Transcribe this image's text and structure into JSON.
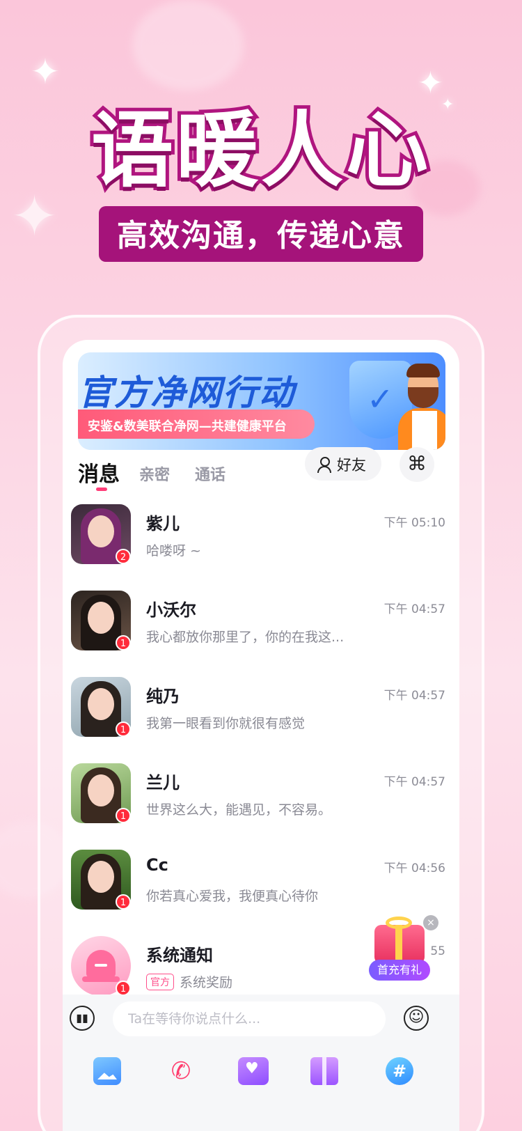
{
  "promo": {
    "headline": "语暖人心",
    "subline": "高效沟通，传递心意"
  },
  "banner": {
    "title": "官方净网行动",
    "subtitle": "安鉴&数美联合净网—共建健康平台"
  },
  "tabs": [
    {
      "label": "消息",
      "active": true
    },
    {
      "label": "亲密",
      "active": false
    },
    {
      "label": "通话",
      "active": false
    }
  ],
  "friends_button": "好友",
  "grid_icon": "⌘",
  "conversations": [
    {
      "name": "紫儿",
      "time": "下午 05:10",
      "preview": "哈喽呀 ~",
      "unread": "2"
    },
    {
      "name": "小沃尔",
      "time": "下午 04:57",
      "preview": "我心都放你那里了，你的在我这...",
      "unread": "1"
    },
    {
      "name": "纯乃",
      "time": "下午 04:57",
      "preview": "我第一眼看到你就很有感觉",
      "unread": "1"
    },
    {
      "name": "兰儿",
      "time": "下午 04:57",
      "preview": "世界这么大，能遇见，不容易。",
      "unread": "1"
    },
    {
      "name": "Cc",
      "time": "下午 04:56",
      "preview": "你若真心爱我，我便真心待你",
      "unread": "1"
    },
    {
      "name": "系统通知",
      "time": "55",
      "tag": "官方",
      "preview": "系统奖励",
      "unread": "1"
    }
  ],
  "gift_float": {
    "label": "首充有礼",
    "close": "×"
  },
  "composer": {
    "placeholder": "Ta在等待你说点什么..."
  },
  "icons": {
    "voice": "voice-wave-icon",
    "emoji": "smile-icon",
    "photo": "photo-icon",
    "call": "phone-call-icon",
    "video": "video-heart-icon",
    "gift": "gift-icon",
    "topic": "hashtag-icon"
  },
  "colors": {
    "brand_pink": "#ff3d78",
    "headline_stroke": "#b0157f",
    "badge": "#ff2b3b"
  }
}
